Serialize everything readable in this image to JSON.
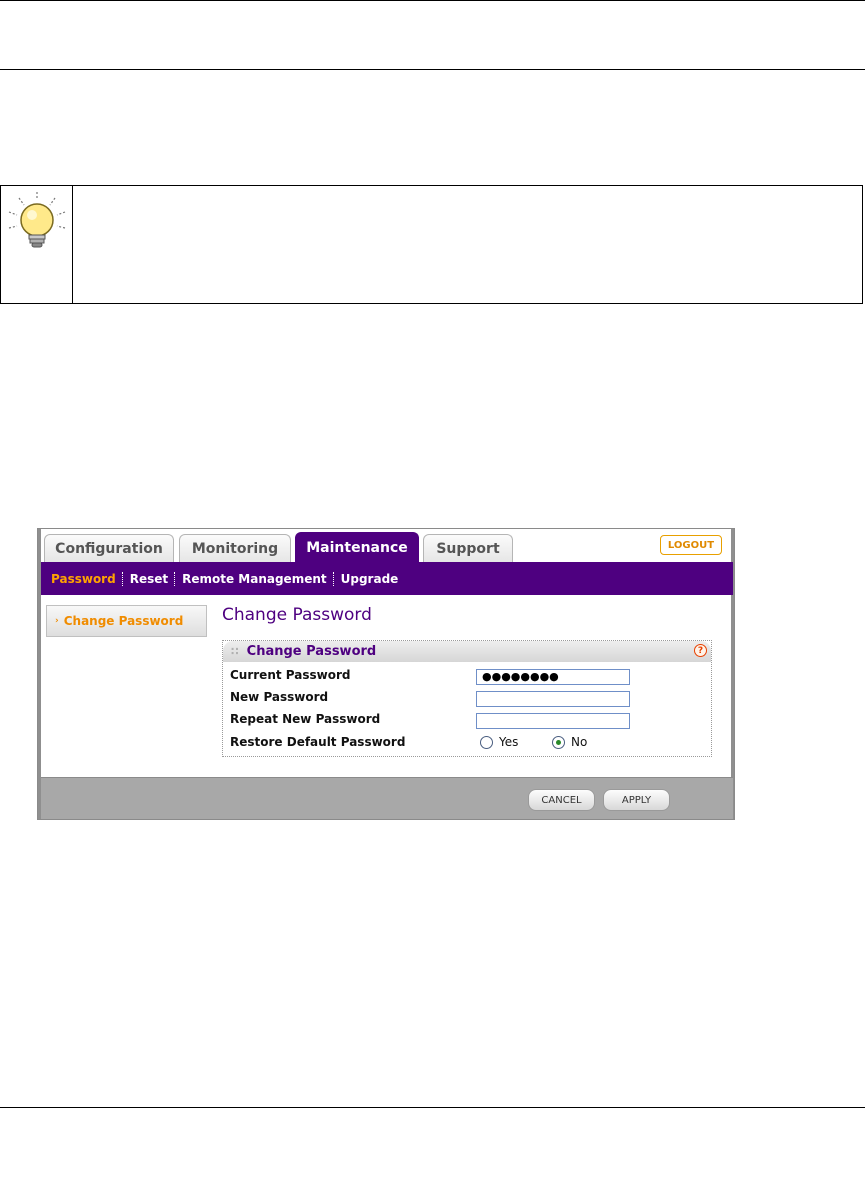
{
  "ui": {
    "tabs": [
      {
        "label": "Configuration"
      },
      {
        "label": "Monitoring"
      },
      {
        "label": "Maintenance"
      },
      {
        "label": "Support"
      }
    ],
    "logout_label": "LOGOUT",
    "subnav": [
      {
        "label": "Password"
      },
      {
        "label": "Reset"
      },
      {
        "label": "Remote Management"
      },
      {
        "label": "Upgrade"
      }
    ],
    "side_button_label": "Change Password",
    "page_heading": "Change Password",
    "section": {
      "title": "Change Password",
      "help_icon_text": "?",
      "current_password_label": "Current Password",
      "current_password_value": "●●●●●●●●",
      "new_password_label": "New Password",
      "new_password_value": "",
      "repeat_password_label": "Repeat New Password",
      "repeat_password_value": "",
      "restore_label": "Restore Default Password",
      "restore_options": [
        {
          "label": "Yes",
          "checked": false
        },
        {
          "label": "No",
          "checked": true
        }
      ]
    },
    "buttons": {
      "cancel_label": "CANCEL",
      "apply_label": "APPLY"
    }
  },
  "icons": {
    "tip": "lightbulb-icon",
    "help": "help-icon",
    "side_arrow": "chevron-right-icon"
  },
  "colors": {
    "brand_purple": "#4e0080",
    "accent_orange": "#ffa300"
  }
}
